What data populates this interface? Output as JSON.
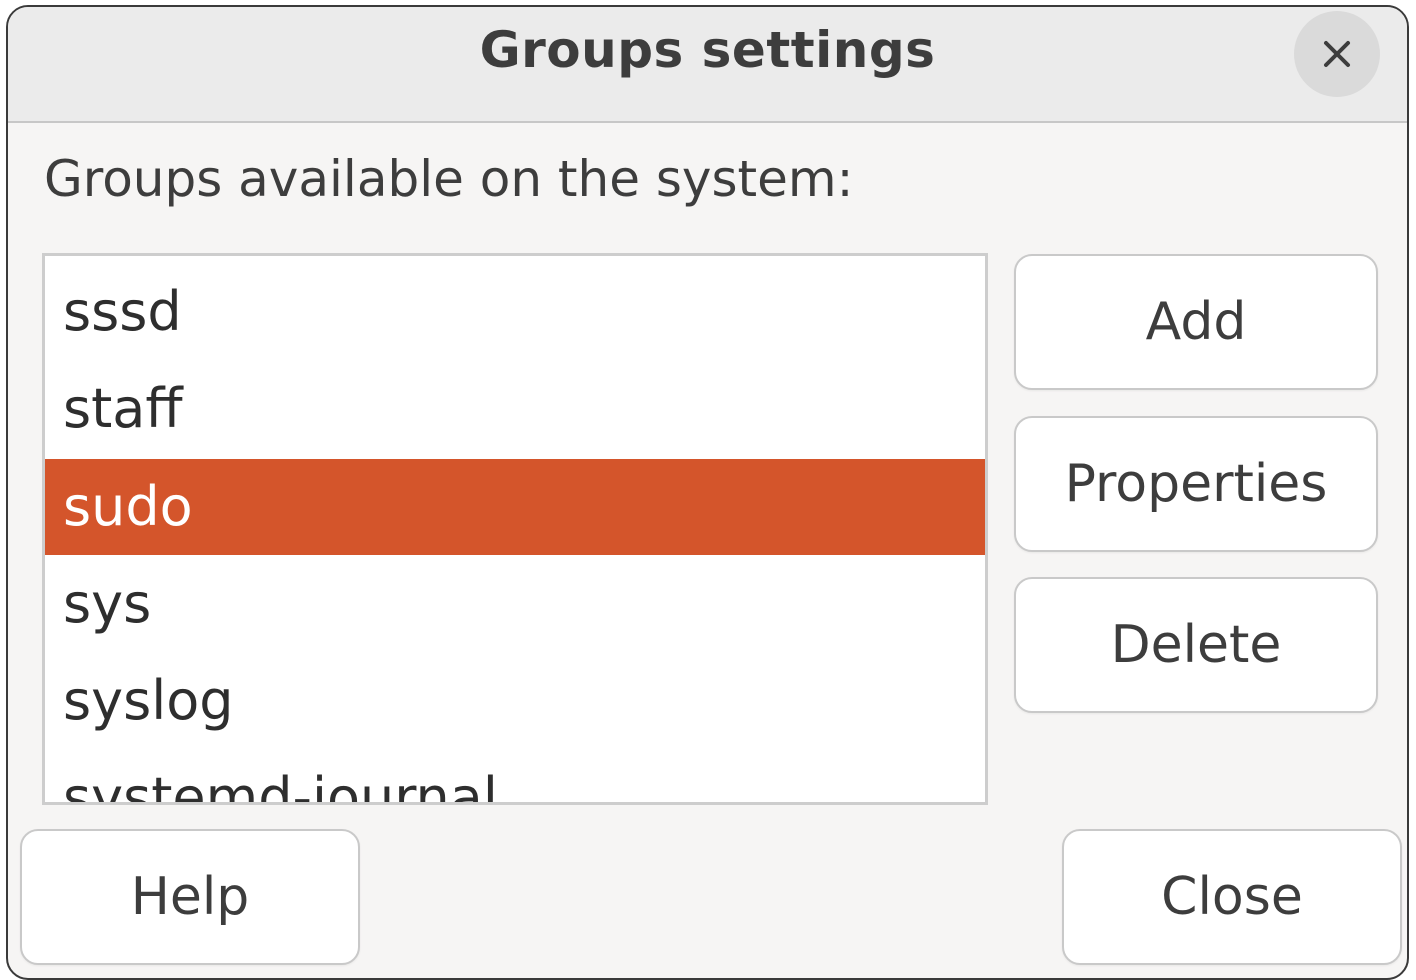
{
  "dialog": {
    "title": "Groups settings",
    "close_icon": "close-icon"
  },
  "label": "Groups available on the system:",
  "groups": [
    {
      "name": "sssd",
      "selected": false
    },
    {
      "name": "staff",
      "selected": false
    },
    {
      "name": "sudo",
      "selected": true
    },
    {
      "name": "sys",
      "selected": false
    },
    {
      "name": "syslog",
      "selected": false
    },
    {
      "name": "systemd-journal",
      "selected": false
    }
  ],
  "buttons": {
    "add": "Add",
    "properties": "Properties",
    "delete": "Delete",
    "help": "Help",
    "close": "Close"
  },
  "colors": {
    "selection": "#d4552b"
  }
}
